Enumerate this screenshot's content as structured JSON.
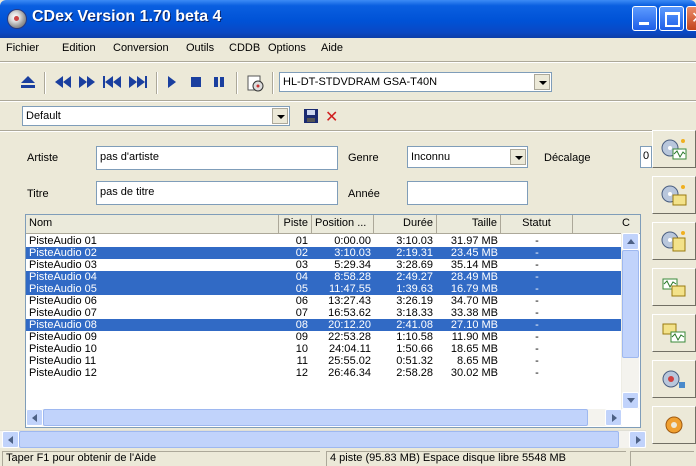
{
  "window": {
    "title": "CDex Version 1.70 beta 4"
  },
  "menu": [
    "Fichier",
    "Edition",
    "Conversion",
    "Outils",
    "CDDB",
    "Options",
    "Aide"
  ],
  "toolbar": {
    "drive": "HL-DT-STDVDRAM GSA-T40N"
  },
  "profile": {
    "value": "Default"
  },
  "form": {
    "artist_label": "Artiste",
    "artist_value": "pas d'artiste",
    "title_label": "Titre",
    "title_value": "pas de titre",
    "genre_label": "Genre",
    "genre_value": "Inconnu",
    "year_label": "Année",
    "year_value": "",
    "offset_label": "Décalage",
    "offset_value": "0"
  },
  "tracks": {
    "columns": [
      "Nom",
      "Piste",
      "Position ...",
      "Durée",
      "Taille",
      "Statut",
      "C"
    ],
    "rows": [
      {
        "name": "PisteAudio 01",
        "track": "01",
        "position": "0:00.00",
        "duration": "3:10.03",
        "size": "31.97 MB",
        "status": "-",
        "selected": false
      },
      {
        "name": "PisteAudio 02",
        "track": "02",
        "position": "3:10.03",
        "duration": "2:19.31",
        "size": "23.45 MB",
        "status": "-",
        "selected": true
      },
      {
        "name": "PisteAudio 03",
        "track": "03",
        "position": "5:29.34",
        "duration": "3:28.69",
        "size": "35.14 MB",
        "status": "-",
        "selected": false
      },
      {
        "name": "PisteAudio 04",
        "track": "04",
        "position": "8:58.28",
        "duration": "2:49.27",
        "size": "28.49 MB",
        "status": "-",
        "selected": true
      },
      {
        "name": "PisteAudio 05",
        "track": "05",
        "position": "11:47.55",
        "duration": "1:39.63",
        "size": "16.79 MB",
        "status": "-",
        "selected": true
      },
      {
        "name": "PisteAudio 06",
        "track": "06",
        "position": "13:27.43",
        "duration": "3:26.19",
        "size": "34.70 MB",
        "status": "-",
        "selected": false
      },
      {
        "name": "PisteAudio 07",
        "track": "07",
        "position": "16:53.62",
        "duration": "3:18.33",
        "size": "33.38 MB",
        "status": "-",
        "selected": false
      },
      {
        "name": "PisteAudio 08",
        "track": "08",
        "position": "20:12.20",
        "duration": "2:41.08",
        "size": "27.10 MB",
        "status": "-",
        "selected": true
      },
      {
        "name": "PisteAudio 09",
        "track": "09",
        "position": "22:53.28",
        "duration": "1:10.58",
        "size": "11.90 MB",
        "status": "-",
        "selected": false
      },
      {
        "name": "PisteAudio 10",
        "track": "10",
        "position": "24:04.11",
        "duration": "1:50.66",
        "size": "18.65 MB",
        "status": "-",
        "selected": false
      },
      {
        "name": "PisteAudio 11",
        "track": "11",
        "position": "25:55.02",
        "duration": "0:51.32",
        "size": "8.65 MB",
        "status": "-",
        "selected": false
      },
      {
        "name": "PisteAudio 12",
        "track": "12",
        "position": "26:46.34",
        "duration": "2:58.28",
        "size": "30.02 MB",
        "status": "-",
        "selected": false
      }
    ]
  },
  "status": {
    "help": "Taper F1 pour obtenir de l'Aide",
    "info": "4 piste (95.83 MB) Espace disque libre  5548 MB"
  },
  "sidebar": [
    "cd-to-wav-icon",
    "cd-to-mp3-icon",
    "cd-to-compressed-icon",
    "wav-to-mp3-icon",
    "mp3-to-wav-icon",
    "cd-player-icon",
    "settings-icon"
  ],
  "colors": {
    "titlebar": "#0052d6",
    "selection": "#316ac5",
    "window": "#ece9d8"
  }
}
